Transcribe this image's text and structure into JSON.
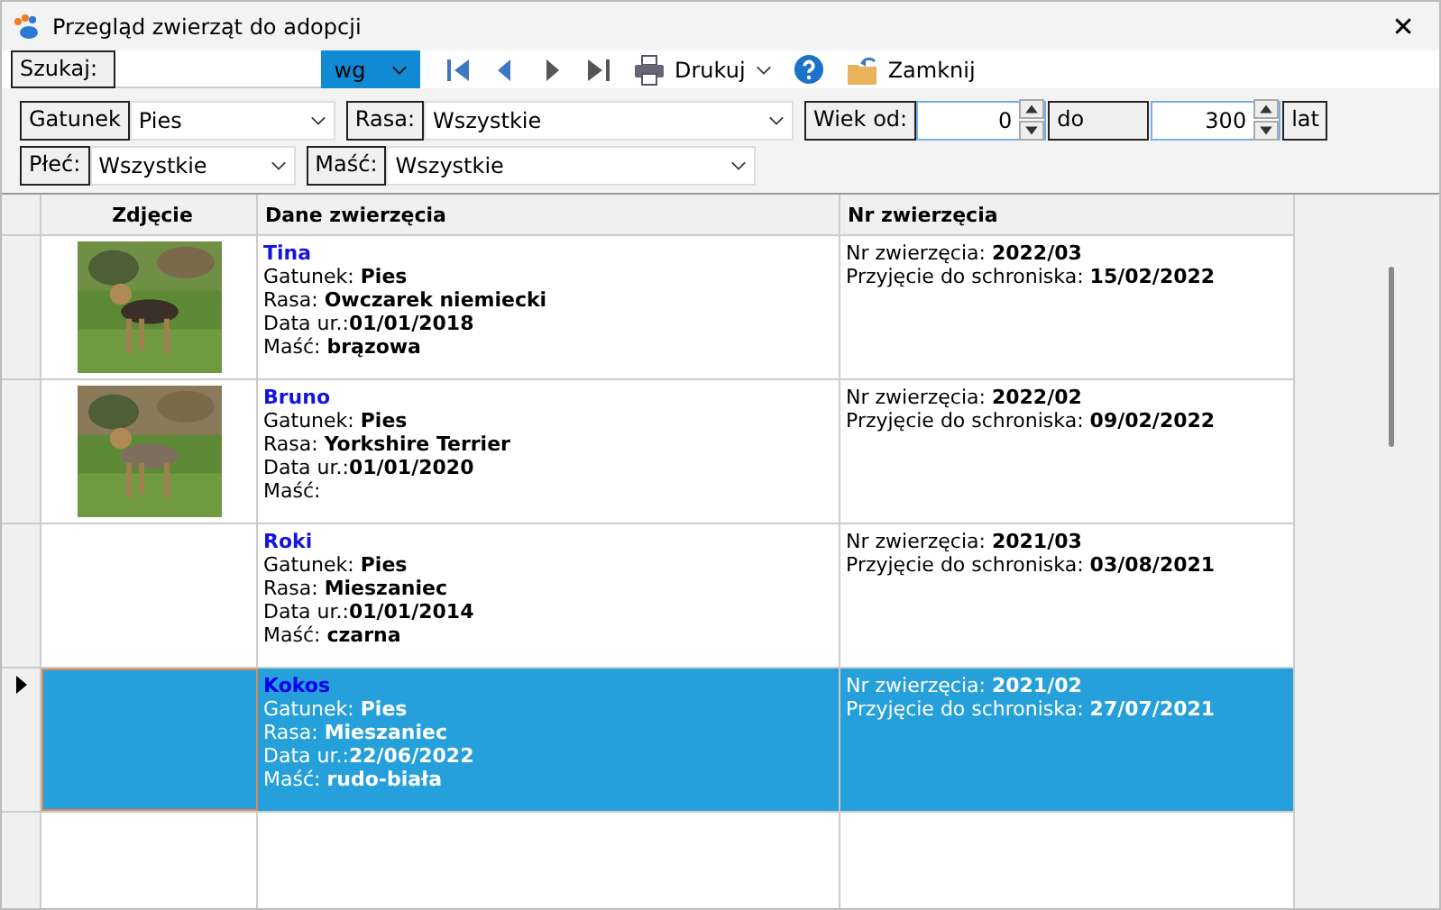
{
  "window": {
    "title": "Przegląd zwierząt do adopcji",
    "close": "✕"
  },
  "toolbar": {
    "search_label": "Szukaj:",
    "by": "wg",
    "print": "Drukuj",
    "close": "Zamknij"
  },
  "filters": [
    {
      "label": "Gatunek",
      "value": "Pies",
      "kind": "select",
      "wide": false
    },
    {
      "label": "Rasa:",
      "value": "Wszystkie",
      "kind": "select",
      "wide": true
    },
    {
      "label": "Wiek od:",
      "value": "0",
      "kind": "spin"
    },
    {
      "label": "do",
      "value": "300",
      "kind": "spin"
    },
    {
      "label": "lat",
      "kind": "label"
    },
    {
      "label": "Płeć:",
      "value": "Wszystkie",
      "kind": "select",
      "wide": false
    },
    {
      "label": "Maść:",
      "value": "Wszystkie",
      "kind": "select",
      "wide": true
    }
  ],
  "table": {
    "columns": [
      "Zdjęcie",
      "Dane zwierzęcia",
      "Nr zwierzęcia"
    ],
    "rows": [
      {
        "selected": false,
        "photo": {
          "kind": "picture"
        },
        "name": "Tina",
        "details": [
          "Gatunek: **Pies**",
          "Rasa: **Owczarek niemiecki**",
          "Data ur.:**01/01/2018**",
          "Maść: **brązowa**"
        ],
        "numbers": [
          "Nr zwierzęcia: **2022/03**",
          "Przyjęcie do schroniska: **15/02/2022**"
        ]
      },
      {
        "selected": false,
        "photo": {
          "kind": "picture"
        },
        "name": "Bruno",
        "details": [
          "Gatunek: **Pies**",
          "Rasa: **Yorkshire Terrier**",
          "Data ur.:**01/01/2020**",
          "Maść:"
        ],
        "numbers": [
          "Nr zwierzęcia: **2022/02**",
          "Przyjęcie do schroniska: **09/02/2022**"
        ]
      },
      {
        "selected": false,
        "name": "Roki",
        "details": [
          "Gatunek: **Pies**",
          "Rasa: **Mieszaniec**",
          "Data ur.:**01/01/2014**",
          "Maść: **czarna**"
        ],
        "numbers": [
          "Nr zwierzęcia: **2021/03**",
          "Przyjęcie do schroniska: **03/08/2021**"
        ]
      },
      {
        "selected": true,
        "name": "Kokos",
        "details": [
          "Gatunek: **Pies**",
          "Rasa: **Mieszaniec**",
          "Data ur.:**22/06/2022**",
          "Maść: **rudo-biała**"
        ],
        "numbers": [
          "Nr zwierzęcia: **2021/02**",
          "Przyjęcie do schroniska: **27/07/2021**"
        ]
      }
    ]
  }
}
